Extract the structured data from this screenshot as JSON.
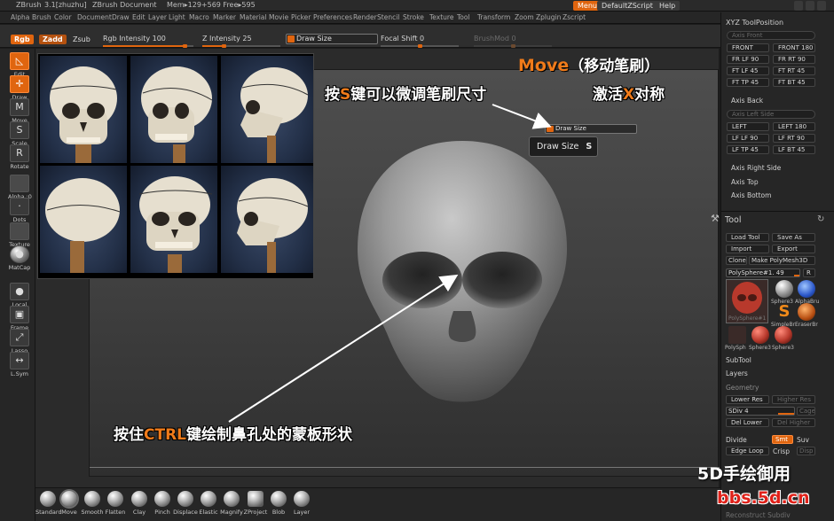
{
  "titlebar": {
    "app": "ZBrush",
    "version": "3.1[zhuzhu]",
    "document": "ZBrush Document",
    "memory": "Mem▸129+569 Free▸595",
    "menus_button": "Menus",
    "script_button": "DefaultZScript",
    "help_button": "Help"
  },
  "menubar": [
    "Alpha",
    "Brush",
    "Color",
    "Document",
    "Draw",
    "Edit",
    "Layer",
    "Light",
    "Macro",
    "Marker",
    "Material",
    "Movie",
    "Picker",
    "Preferences",
    "Render",
    "Stencil",
    "Stroke",
    "Texture",
    "Tool",
    "Transform",
    "Zoom",
    "Zplugin",
    "Zscript"
  ],
  "topbar": {
    "rgb": "Rgb",
    "zadd": "Zadd",
    "zsub": "Zsub",
    "rgb_intensity_label": "Rgb Intensity",
    "rgb_intensity_value": "100",
    "z_intensity_label": "Z Intensity",
    "z_intensity_value": "25",
    "draw_size_label": "Draw Size",
    "focal_shift_label": "Focal Shift",
    "focal_shift_value": "0",
    "brushmod_label": "BrushMod",
    "brushmod_value": "0"
  },
  "leftshelf": [
    {
      "label": "Edit",
      "icon": "◺"
    },
    {
      "label": "Draw",
      "icon": "✛"
    },
    {
      "label": "Move",
      "icon": "M"
    },
    {
      "label": "Scale",
      "icon": "S"
    },
    {
      "label": "Rotate",
      "icon": "R"
    },
    {
      "label": "Alpha :0",
      "icon": ""
    },
    {
      "label": "Dots",
      "icon": "·"
    },
    {
      "label": "Texture",
      "icon": ""
    },
    {
      "label": "MatCap",
      "icon": "●"
    },
    {
      "label": "Local",
      "icon": "●"
    },
    {
      "label": "Frame",
      "icon": "▣"
    },
    {
      "label": "Lasso",
      "icon": "⤢"
    },
    {
      "label": "L.Sym",
      "icon": "↔"
    }
  ],
  "canvas": {
    "drawsize_field": "Draw Size",
    "drawsize_tooltip": "Draw Size",
    "drawsize_hotkey": "S",
    "annotation_move_title": "Move",
    "annotation_move_sub": "（移动笔刷）",
    "annotation_s_pre": "按",
    "annotation_s_key": "S",
    "annotation_s_post": "键可以微调笔刷尺寸",
    "annotation_x_pre": "激活",
    "annotation_x_key": "X",
    "annotation_x_post": "对称",
    "annotation_ctrl_pre": "按住",
    "annotation_ctrl_key": "CTRL",
    "annotation_ctrl_post": "键绘制鼻孔处的蒙板形状"
  },
  "rightpanel": {
    "header": "XYZ ToolPosition",
    "axis_front": "Axis Front",
    "front_buttons": [
      "FRONT",
      "FRONT 180",
      "FR LF 90",
      "FR RT 90",
      "FT LF 45",
      "FT RT 45",
      "FT TP 45",
      "FT BT 45"
    ],
    "axis_back": "Axis Back",
    "axis_left_side": "Axis Left Side",
    "left_buttons": [
      "LEFT",
      "LEFT 180",
      "LF LF 90",
      "LF RT 90",
      "LF TP 45",
      "LF BT 45"
    ],
    "axis_right_side": "Axis Right Side",
    "axis_top": "Axis Top",
    "axis_bottom": "Axis Bottom",
    "tool_title": "Tool",
    "load_tool": "Load Tool",
    "save_as": "Save As",
    "import": "Import",
    "export": "Export",
    "clone": "Clone",
    "make_polymesh": "Make PolyMesh3D",
    "polysphere": "PolySphere#1. 49",
    "r_button": "R",
    "thumb_labels": [
      "Sphere3",
      "AlphaBru",
      "SimpleBr",
      "EraserBr",
      "PolySph",
      "Sphere3",
      "Sphere3"
    ],
    "main_thumb_label": "PolySphere#1",
    "subtool": "SubTool",
    "layers": "Layers",
    "geometry": "Geometry",
    "lower_res": "Lower Res",
    "higher_res": "Higher Res",
    "sdiv": "SDiv 4",
    "cage": "Cage",
    "del_lower": "Del Lower",
    "del_higher": "Del Higher",
    "divide": "Divide",
    "smt": "Smt",
    "suv": "Suv",
    "edge_loop": "Edge Loop",
    "crisp": "Crisp",
    "disp": "Disp",
    "reconstruct": "Reconstruct Subdiv"
  },
  "bottomshelf": [
    "Standard",
    "Move",
    "Smooth",
    "Flatten",
    "Clay",
    "Pinch",
    "Displace",
    "Elastic",
    "Magnify",
    "ZProject",
    "Blob",
    "Layer"
  ],
  "watermark": {
    "line1": "5D手绘御用",
    "line2": "bbs.5d.cn"
  },
  "colors": {
    "accent": "#e0650f",
    "annotation_orange": "#f07b1a",
    "watermark_red": "#e0221a"
  }
}
